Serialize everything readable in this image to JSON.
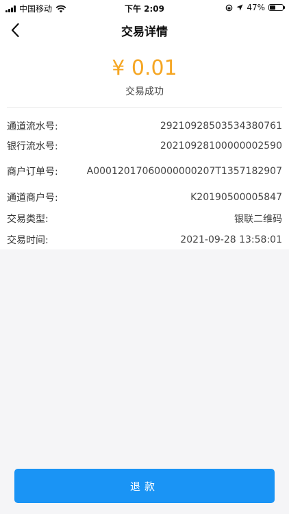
{
  "status_bar": {
    "carrier": "中国移动",
    "time": "下午 2:09",
    "battery": "47%",
    "battery_level": 0.47
  },
  "nav": {
    "title": "交易详情"
  },
  "transaction": {
    "amount": "¥ 0.01",
    "status": "交易成功",
    "details": [
      {
        "label": "通道流水号:",
        "value": "29210928503534380761"
      },
      {
        "label": "银行流水号:",
        "value": "20210928100000002590"
      },
      {
        "label": "商户订单号:",
        "value": "A0001201706000000020​7T1357182907"
      },
      {
        "label": "通道商户号:",
        "value": "K20190500005847"
      },
      {
        "label": "交易类型:",
        "value": "银联二维码"
      },
      {
        "label": "交易时间:",
        "value": "2021-09-28 13:58:01"
      }
    ]
  },
  "actions": {
    "refund_label": "退款"
  }
}
